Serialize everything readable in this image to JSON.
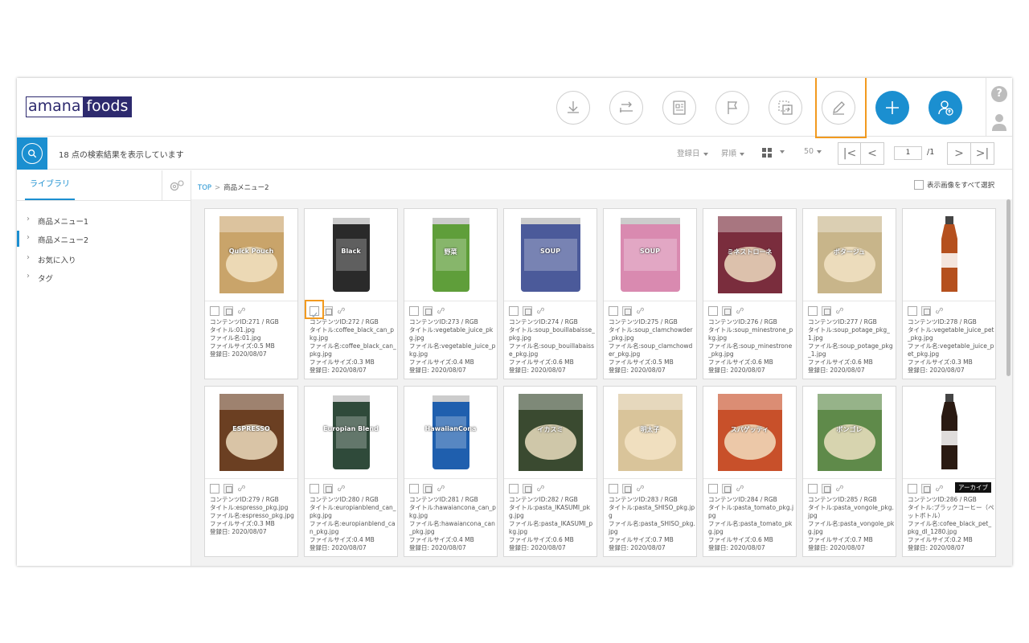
{
  "brand": {
    "logo_left": "amana",
    "logo_right": "foods",
    "logo_color": "#2d2a6e"
  },
  "accent_color": "#1b8fd0",
  "highlight_color": "#f29a1f",
  "header": {
    "tools": [
      {
        "icon": "download-icon"
      },
      {
        "icon": "transfer-icon"
      },
      {
        "icon": "document-icon"
      },
      {
        "icon": "flag-icon"
      },
      {
        "icon": "move-icon"
      },
      {
        "icon": "edit-icon"
      },
      {
        "icon": "add-icon"
      },
      {
        "icon": "user-upload-icon"
      }
    ],
    "help_label": "?"
  },
  "toolbar": {
    "result_text": "18 点の検索結果を表示しています",
    "sort_by": "登録日",
    "order": "昇順",
    "per_page": "50",
    "page_current": "1",
    "page_total": "/1",
    "first_label": "|<",
    "prev_label": "<",
    "next_label": ">",
    "last_label": ">|"
  },
  "sidebar": {
    "tab_label": "ライブラリ",
    "items": [
      {
        "label": "商品メニュー1"
      },
      {
        "label": "商品メニュー2"
      },
      {
        "label": "お気に入り"
      },
      {
        "label": "タグ"
      }
    ]
  },
  "main": {
    "breadcrumb_top": "TOP",
    "breadcrumb_sep": ">",
    "breadcrumb_current": "商品メニュー2",
    "select_all_label": "表示画像をすべて選択",
    "archive_badge": "アーカイブ",
    "cards": [
      {
        "lines": [
          "コンテンツID:271 / RGB",
          "タイトル:01.jpg",
          "ファイル名:01.jpg",
          "ファイルサイズ:0.5 MB",
          "登録日: 2020/08/07"
        ],
        "color": "#c9a46a",
        "label": "Quick Pouch"
      },
      {
        "lines": [
          "コンテンツID:272 / RGB",
          "タイトル:coffee_black_can_pkg.jpg",
          "ファイル名:coffee_black_can_pkg.jpg",
          "ファイルサイズ:0.3 MB",
          "登録日: 2020/08/07"
        ],
        "color": "#2a2a2a",
        "label": "Black"
      },
      {
        "lines": [
          "コンテンツID:273 / RGB",
          "タイトル:vegetable_juice_pkg.jpg",
          "ファイル名:vegetable_juice_pkg.jpg",
          "ファイルサイズ:0.4 MB",
          "登録日: 2020/08/07"
        ],
        "color": "#5f9e3a",
        "label": "野菜"
      },
      {
        "lines": [
          "コンテンツID:274 / RGB",
          "タイトル:soup_bouillabaisse_pkg.jpg",
          "ファイル名:soup_bouillabaisse_pkg.jpg",
          "ファイルサイズ:0.6 MB",
          "登録日: 2020/08/07"
        ],
        "color": "#4b5a9a",
        "label": "SOUP"
      },
      {
        "lines": [
          "コンテンツID:275 / RGB",
          "タイトル:soup_clamchowder_pkg.jpg",
          "ファイル名:soup_clamchowder_pkg.jpg",
          "ファイルサイズ:0.5 MB",
          "登録日: 2020/08/07"
        ],
        "color": "#d98ab0",
        "label": "SOUP"
      },
      {
        "lines": [
          "コンテンツID:276 / RGB",
          "タイトル:soup_minestrone_pkg.jpg",
          "ファイル名:soup_minestrone_pkg.jpg",
          "ファイルサイズ:0.6 MB",
          "登録日: 2020/08/07"
        ],
        "color": "#7a2d3d",
        "label": "ミネストローネ"
      },
      {
        "lines": [
          "コンテンツID:277 / RGB",
          "タイトル:soup_potage_pkg_1.jpg",
          "ファイル名:soup_potage_pkg_1.jpg",
          "ファイルサイズ:0.6 MB",
          "登録日: 2020/08/07"
        ],
        "color": "#c8b58a",
        "label": "ポタージュ"
      },
      {
        "lines": [
          "コンテンツID:278 / RGB",
          "タイトル:vegetable_juice_pet_pkg.jpg",
          "ファイル名:vegetable_juice_pet_pkg.jpg",
          "ファイルサイズ:0.3 MB",
          "登録日: 2020/08/07"
        ],
        "color": "#b5501e",
        "label": ""
      },
      {
        "lines": [
          "コンテンツID:279 / RGB",
          "タイトル:espresso_pkg.jpg",
          "ファイル名:espresso_pkg.jpg",
          "ファイルサイズ:0.3 MB",
          "登録日: 2020/08/07"
        ],
        "color": "#6b3f22",
        "label": "ESPRESSO"
      },
      {
        "lines": [
          "コンテンツID:280 / RGB",
          "タイトル:europianblend_can_pkg.jpg",
          "ファイル名:europianblend_can_pkg.jpg",
          "ファイルサイズ:0.4 MB",
          "登録日: 2020/08/07"
        ],
        "color": "#2f4a3a",
        "label": "Europian Blend"
      },
      {
        "lines": [
          "コンテンツID:281 / RGB",
          "タイトル:hawaiancona_can_pkg.jpg",
          "ファイル名:hawaiancona_can_pkg.jpg",
          "ファイルサイズ:0.4 MB",
          "登録日: 2020/08/07"
        ],
        "color": "#1f5fae",
        "label": "HawaiianCona"
      },
      {
        "lines": [
          "コンテンツID:282 / RGB",
          "タイトル:pasta_IKASUMI_pkg.jpg",
          "ファイル名:pasta_IKASUMI_pkg.jpg",
          "ファイルサイズ:0.6 MB",
          "登録日: 2020/08/07"
        ],
        "color": "#3a4a30",
        "label": "イカスミ"
      },
      {
        "lines": [
          "コンテンツID:283 / RGB",
          "タイトル:pasta_SHISO_pkg.jpg",
          "ファイル名:pasta_SHISO_pkg.jpg",
          "ファイルサイズ:0.7 MB",
          "登録日: 2020/08/07"
        ],
        "color": "#d9c49a",
        "label": "明太子"
      },
      {
        "lines": [
          "コンテンツID:284 / RGB",
          "タイトル:pasta_tomato_pkg.jpg",
          "ファイル名:pasta_tomato_pkg.jpg",
          "ファイルサイズ:0.6 MB",
          "登録日: 2020/08/07"
        ],
        "color": "#c8502a",
        "label": "スパゲッティ"
      },
      {
        "lines": [
          "コンテンツID:285 / RGB",
          "タイトル:pasta_vongole_pkg.jpg",
          "ファイル名:pasta_vongole_pkg.jpg",
          "ファイルサイズ:0.7 MB",
          "登録日: 2020/08/07"
        ],
        "color": "#5f8a4a",
        "label": "ボンゴレ"
      },
      {
        "lines": [
          "コンテンツID:286 / RGB",
          "タイトル:ブラックコーヒー（ペットボトル）",
          "ファイル名:cofee_black_pet_pkg_dl_1280.jpg",
          "ファイルサイズ:0.2 MB",
          "登録日: 2020/08/07"
        ],
        "color": "#2a1a12",
        "label": "",
        "archived": true
      }
    ]
  }
}
